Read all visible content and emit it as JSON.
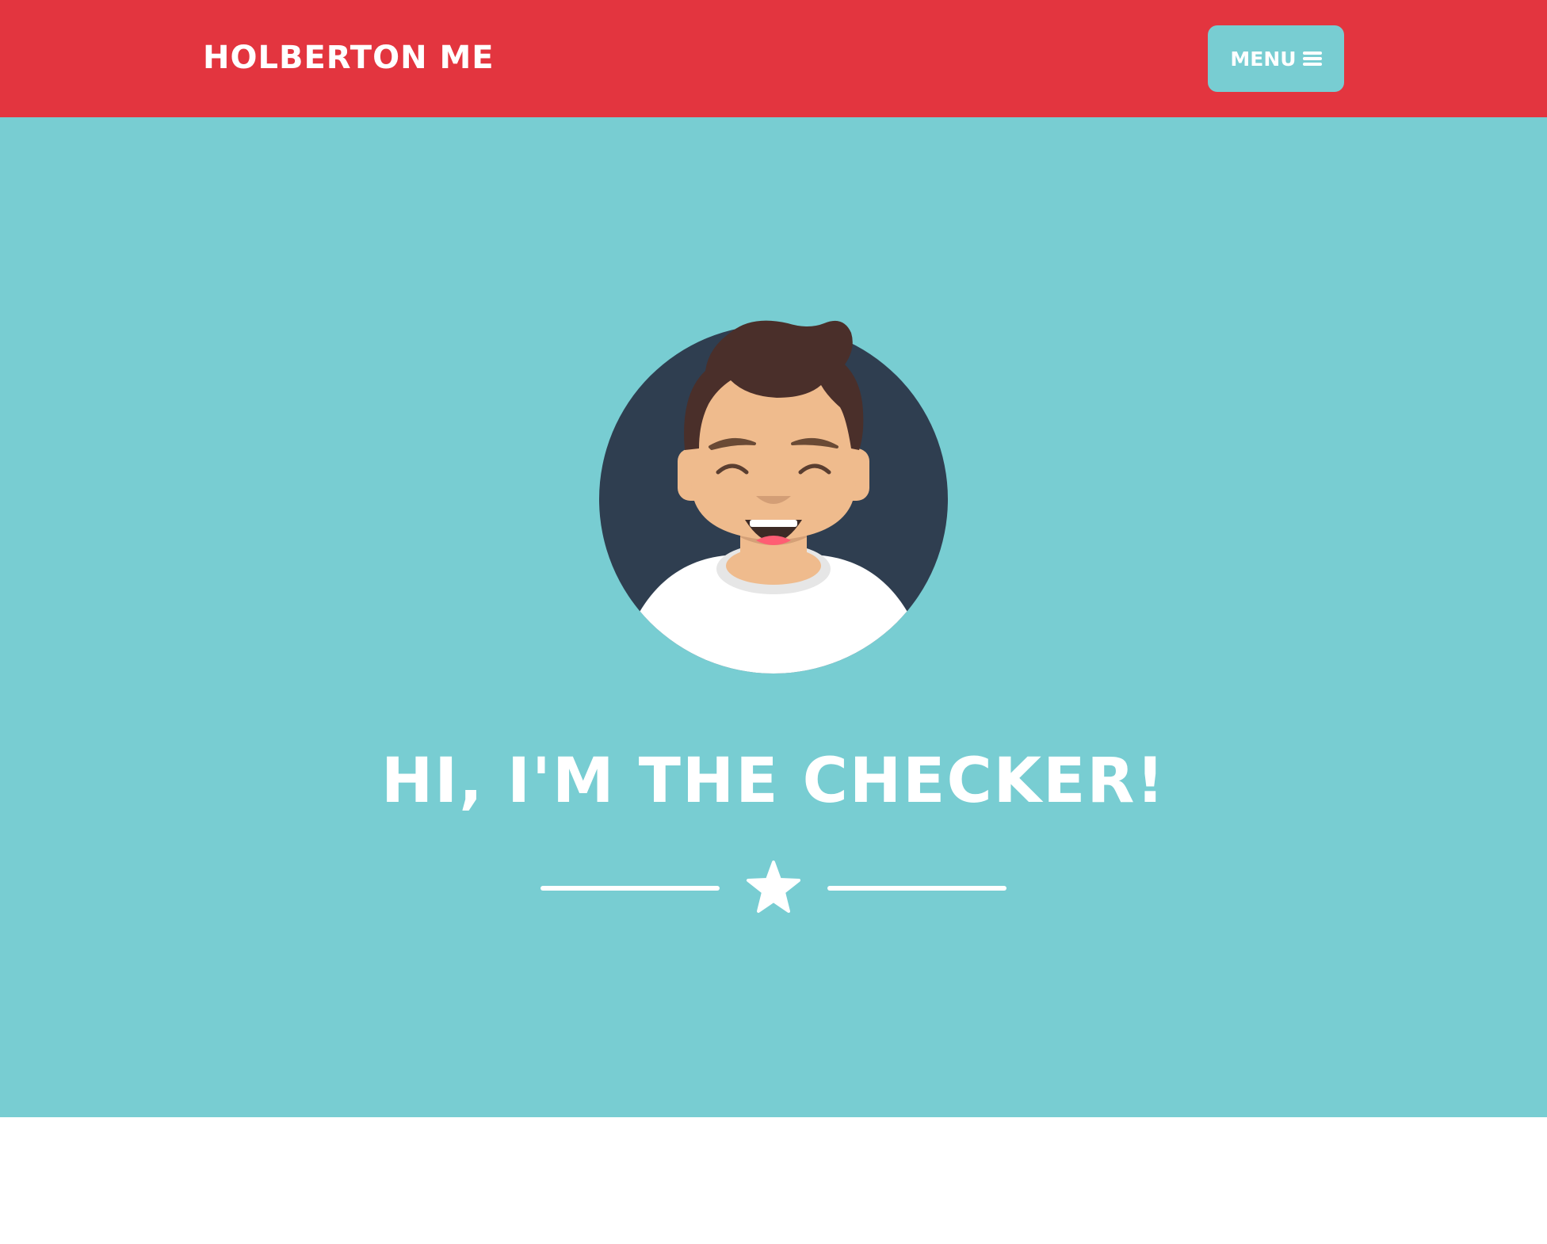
{
  "navbar": {
    "brand": "HOLBERTON ME",
    "menu_label": "MENU",
    "menu_icon": "hamburger-icon",
    "background": "#e3353f",
    "button_color": "#78cdd2"
  },
  "hero": {
    "background": "#78cdd2",
    "avatar_icon": "avatar-illustration",
    "headline": "HI, I'M THE CHECKER!",
    "divider_icon": "star-icon"
  }
}
